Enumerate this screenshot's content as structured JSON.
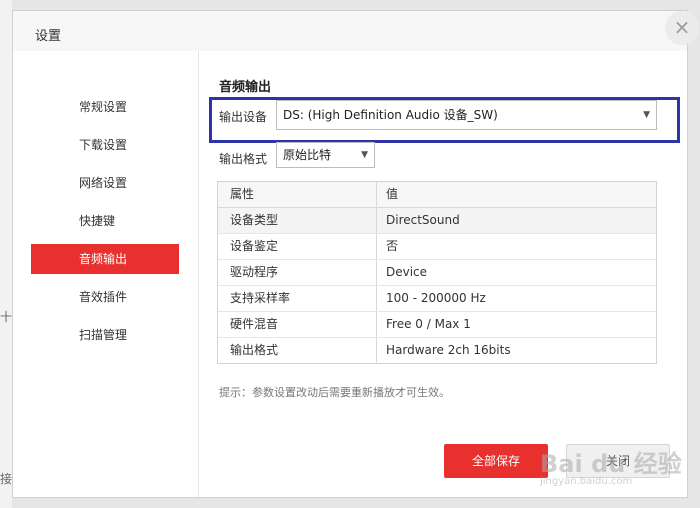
{
  "dialog": {
    "title": "设置",
    "close_glyph": "×"
  },
  "sidebar": {
    "items": [
      {
        "label": "常规设置",
        "active": false
      },
      {
        "label": "下载设置",
        "active": false
      },
      {
        "label": "网络设置",
        "active": false
      },
      {
        "label": "快捷键",
        "active": false
      },
      {
        "label": "音频输出",
        "active": true
      },
      {
        "label": "音效插件",
        "active": false
      },
      {
        "label": "扫描管理",
        "active": false
      }
    ]
  },
  "audio": {
    "section_title": "音频输出",
    "device_label": "输出设备",
    "device_value": "DS: (High Definition Audio 设备_SW)",
    "format_label": "输出格式",
    "format_value": "原始比特"
  },
  "properties": {
    "columns": [
      "属性",
      "值"
    ],
    "rows": [
      [
        "设备类型",
        "DirectSound"
      ],
      [
        "设备鉴定",
        "否"
      ],
      [
        "驱动程序",
        "Device"
      ],
      [
        "支持采样率",
        "100 - 200000 Hz"
      ],
      [
        "硬件混音",
        "Free 0 / Max 1"
      ],
      [
        "输出格式",
        "Hardware 2ch 16bits"
      ]
    ]
  },
  "hint": "提示：参数设置改动后需要重新播放才可生效。",
  "buttons": {
    "save_label": "全部保存",
    "cancel_label": "关闭"
  },
  "watermark": {
    "main": "Bai du 经验",
    "sub": "jingyan.baidu.com"
  },
  "background": {
    "mark1": "十",
    "mark2": "接"
  },
  "colors": {
    "accent": "#e8312f",
    "highlight_frame": "#2e33a8"
  }
}
